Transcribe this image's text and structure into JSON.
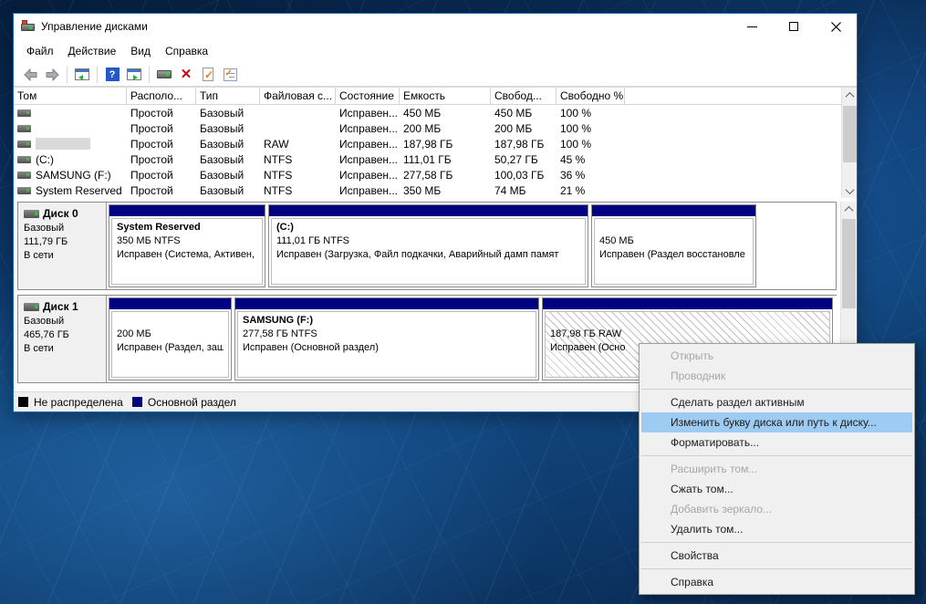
{
  "colors": {
    "accent_border": "#0f67b1",
    "partition_header": "#010181",
    "menu_highlight": "#9ecbf1",
    "unallocated": "#000000"
  },
  "window": {
    "title": "Управление дисками",
    "controls": [
      "minimize",
      "maximize",
      "close"
    ],
    "menu_items": [
      "Файл",
      "Действие",
      "Вид",
      "Справка"
    ],
    "toolbar_icons": [
      "back",
      "forward",
      "console-tree",
      "help",
      "action-pane",
      "disk-view",
      "delete-volume",
      "mark-partition",
      "checklist"
    ]
  },
  "volume_table": {
    "columns": [
      "Том",
      "Располо...",
      "Тип",
      "Файловая с...",
      "Состояние",
      "Емкость",
      "Свобод...",
      "Свободно %"
    ],
    "rows": [
      {
        "volume": "",
        "layout": "Простой",
        "type": "Базовый",
        "fs": "",
        "status": "Исправен...",
        "capacity": "450 МБ",
        "free": "450 МБ",
        "free_pct": "100 %"
      },
      {
        "volume": "",
        "layout": "Простой",
        "type": "Базовый",
        "fs": "",
        "status": "Исправен...",
        "capacity": "200 МБ",
        "free": "200 МБ",
        "free_pct": "100 %"
      },
      {
        "volume": "",
        "layout": "Простой",
        "type": "Базовый",
        "fs": "RAW",
        "status": "Исправен...",
        "capacity": "187,98 ГБ",
        "free": "187,98 ГБ",
        "free_pct": "100 %"
      },
      {
        "volume": "(C:)",
        "layout": "Простой",
        "type": "Базовый",
        "fs": "NTFS",
        "status": "Исправен...",
        "capacity": "111,01 ГБ",
        "free": "50,27 ГБ",
        "free_pct": "45 %"
      },
      {
        "volume": "SAMSUNG (F:)",
        "layout": "Простой",
        "type": "Базовый",
        "fs": "NTFS",
        "status": "Исправен...",
        "capacity": "277,58 ГБ",
        "free": "100,03 ГБ",
        "free_pct": "36 %"
      },
      {
        "volume": "System Reserved",
        "layout": "Простой",
        "type": "Базовый",
        "fs": "NTFS",
        "status": "Исправен...",
        "capacity": "350 МБ",
        "free": "74 МБ",
        "free_pct": "21 %"
      }
    ]
  },
  "disks": [
    {
      "name": "Диск 0",
      "kind": "Базовый",
      "size": "111,79 ГБ",
      "status": "В сети",
      "partitions": [
        {
          "title": "System Reserved",
          "line2": "350 МБ NTFS",
          "line3": "Исправен (Система, Активен,"
        },
        {
          "title": "(C:)",
          "line2": "111,01 ГБ NTFS",
          "line3": "Исправен (Загрузка, Файл подкачки, Аварийный дамп памят"
        },
        {
          "title": "",
          "line2": "450 МБ",
          "line3": "Исправен (Раздел восстановле"
        }
      ]
    },
    {
      "name": "Диск 1",
      "kind": "Базовый",
      "size": "465,76 ГБ",
      "status": "В сети",
      "partitions": [
        {
          "title": "",
          "line2": "200 МБ",
          "line3": "Исправен (Раздел, заш"
        },
        {
          "title": "SAMSUNG  (F:)",
          "line2": "277,58 ГБ NTFS",
          "line3": "Исправен (Основной раздел)"
        },
        {
          "title": "",
          "line2": "187,98 ГБ RAW",
          "line3": "Исправен (Осно"
        }
      ]
    }
  ],
  "legend": [
    {
      "label": "Не распределена",
      "color": "#000000"
    },
    {
      "label": "Основной раздел",
      "color": "#010181"
    }
  ],
  "context_menu": {
    "items": [
      {
        "label": "Открыть",
        "state": "disabled"
      },
      {
        "label": "Проводник",
        "state": "disabled"
      },
      {
        "label": "Сделать раздел активным",
        "state": "enabled"
      },
      {
        "label": "Изменить букву диска или путь к диску...",
        "state": "highlighted"
      },
      {
        "label": "Форматировать...",
        "state": "enabled"
      },
      {
        "label": "Расширить том...",
        "state": "disabled"
      },
      {
        "label": "Сжать том...",
        "state": "enabled"
      },
      {
        "label": "Добавить зеркало...",
        "state": "disabled"
      },
      {
        "label": "Удалить том...",
        "state": "enabled"
      },
      {
        "label": "Свойства",
        "state": "enabled"
      },
      {
        "label": "Справка",
        "state": "enabled"
      }
    ]
  }
}
